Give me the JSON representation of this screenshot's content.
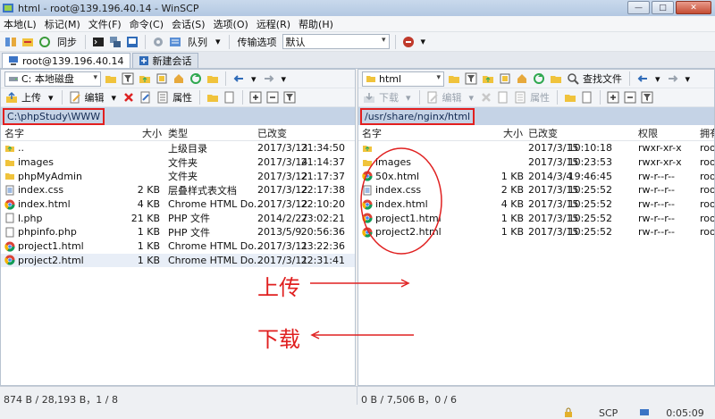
{
  "window": {
    "title": "html - root@139.196.40.14 - WinSCP"
  },
  "menu": [
    "本地(L)",
    "标记(M)",
    "文件(F)",
    "命令(C)",
    "会话(S)",
    "选项(O)",
    "远程(R)",
    "帮助(H)"
  ],
  "toolbar": {
    "sync_label": "同步",
    "queue_label": "队列",
    "transfer_label": "传输选项",
    "preset_value": "默认"
  },
  "tabs": [
    {
      "label": "root@139.196.40.14"
    },
    {
      "label": "新建会话"
    }
  ],
  "left": {
    "drive": "C: 本地磁盘",
    "upload_label": "上传",
    "edit_label": "编辑",
    "properties_label": "属性",
    "path": "C:\\phpStudy\\WWW",
    "columns": {
      "name": "名字",
      "size": "大小",
      "type": "类型",
      "modified": "已改变"
    },
    "files": [
      {
        "name": "..",
        "size": "",
        "type": "上级目录",
        "date": "2017/3/13",
        "time": "21:34:50",
        "icon": "parent-folder"
      },
      {
        "name": "images",
        "size": "",
        "type": "文件夹",
        "date": "2017/3/14",
        "time": "21:14:37",
        "icon": "folder"
      },
      {
        "name": "phpMyAdmin",
        "size": "",
        "type": "文件夹",
        "date": "2017/3/12",
        "time": "21:17:37",
        "icon": "folder"
      },
      {
        "name": "index.css",
        "size": "2 KB",
        "type": "层叠样式表文档",
        "date": "2017/3/12",
        "time": "22:17:38",
        "icon": "css-file"
      },
      {
        "name": "index.html",
        "size": "4 KB",
        "type": "Chrome HTML Do...",
        "date": "2017/3/12",
        "time": "22:10:20",
        "icon": "chrome"
      },
      {
        "name": "l.php",
        "size": "21 KB",
        "type": "PHP 文件",
        "date": "2014/2/27",
        "time": "23:02:21",
        "icon": "file"
      },
      {
        "name": "phpinfo.php",
        "size": "1 KB",
        "type": "PHP 文件",
        "date": "2013/5/9",
        "time": "20:56:36",
        "icon": "file"
      },
      {
        "name": "project1.html",
        "size": "1 KB",
        "type": "Chrome HTML Do...",
        "date": "2017/3/11",
        "time": "23:22:36",
        "icon": "chrome"
      },
      {
        "name": "project2.html",
        "size": "1 KB",
        "type": "Chrome HTML Do...",
        "date": "2017/3/11",
        "time": "22:31:41",
        "icon": "chrome"
      }
    ],
    "status": "874 B / 28,193 B，1 / 8"
  },
  "right": {
    "drive": "html",
    "find_label": "查找文件",
    "download_label": "下载",
    "edit_label": "编辑",
    "properties_label": "属性",
    "path": "/usr/share/nginx/html",
    "columns": {
      "name": "名字",
      "size": "大小",
      "modified": "已改变",
      "rights": "权限",
      "owner": "拥有"
    },
    "files": [
      {
        "name": "",
        "size": "",
        "date": "2017/3/15",
        "time": "10:10:18",
        "rights": "rwxr-xr-x",
        "owner": "root",
        "icon": "parent-folder"
      },
      {
        "name": "images",
        "size": "",
        "date": "2017/3/15",
        "time": "10:23:53",
        "rights": "rwxr-xr-x",
        "owner": "root",
        "icon": "folder"
      },
      {
        "name": "50x.html",
        "size": "1 KB",
        "date": "2014/3/4",
        "time": "19:46:45",
        "rights": "rw-r--r--",
        "owner": "root",
        "icon": "chrome"
      },
      {
        "name": "index.css",
        "size": "2 KB",
        "date": "2017/3/15",
        "time": "10:25:52",
        "rights": "rw-r--r--",
        "owner": "root",
        "icon": "css-file"
      },
      {
        "name": "index.html",
        "size": "4 KB",
        "date": "2017/3/15",
        "time": "10:25:52",
        "rights": "rw-r--r--",
        "owner": "root",
        "icon": "chrome"
      },
      {
        "name": "project1.html",
        "size": "1 KB",
        "date": "2017/3/15",
        "time": "10:25:52",
        "rights": "rw-r--r--",
        "owner": "root",
        "icon": "chrome"
      },
      {
        "name": "project2.html",
        "size": "1 KB",
        "date": "2017/3/15",
        "time": "10:25:52",
        "rights": "rw-r--r--",
        "owner": "root",
        "icon": "chrome"
      }
    ],
    "status": "0 B / 7,506 B，0 / 6"
  },
  "bottom": {
    "protocol": "SCP",
    "elapsed": "0:05:09"
  },
  "annotations": {
    "upload": "上传",
    "download": "下载"
  },
  "colors": {
    "annotation_red": "#e02020",
    "path_bar": "#c5d3e6"
  }
}
